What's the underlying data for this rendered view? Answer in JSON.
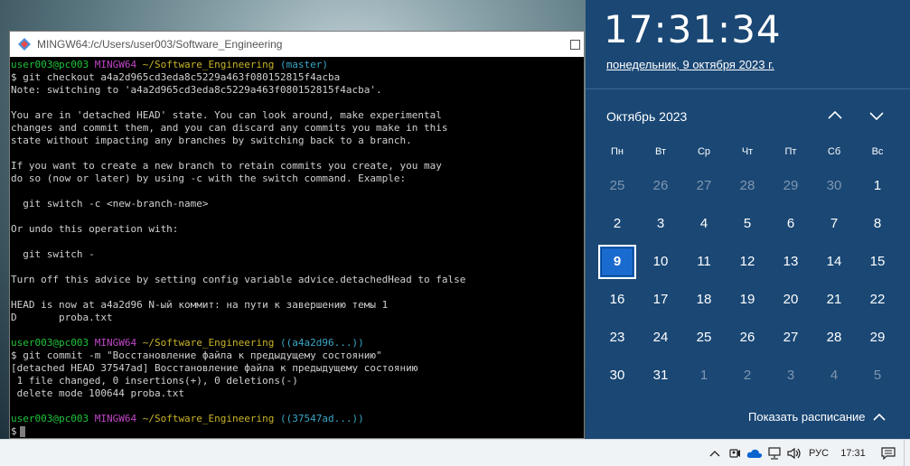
{
  "terminal": {
    "title": "MINGW64:/c/Users/user003/Software_Engineering",
    "lines": [
      [
        {
          "t": "user003@pc003 ",
          "c": "green"
        },
        {
          "t": "MINGW64 ",
          "c": "mag"
        },
        {
          "t": "~/Software_Engineering ",
          "c": "yel"
        },
        {
          "t": "(master)",
          "c": "cyan"
        }
      ],
      [
        {
          "t": "$ git checkout a4a2d965cd3eda8c5229a463f080152815f4acba",
          "c": ""
        }
      ],
      [
        {
          "t": "Note: switching to 'a4a2d965cd3eda8c5229a463f080152815f4acba'.",
          "c": ""
        }
      ],
      [
        {
          "t": "",
          "c": ""
        }
      ],
      [
        {
          "t": "You are in 'detached HEAD' state. You can look around, make experimental",
          "c": ""
        }
      ],
      [
        {
          "t": "changes and commit them, and you can discard any commits you make in this",
          "c": ""
        }
      ],
      [
        {
          "t": "state without impacting any branches by switching back to a branch.",
          "c": ""
        }
      ],
      [
        {
          "t": "",
          "c": ""
        }
      ],
      [
        {
          "t": "If you want to create a new branch to retain commits you create, you may",
          "c": ""
        }
      ],
      [
        {
          "t": "do so (now or later) by using -c with the switch command. Example:",
          "c": ""
        }
      ],
      [
        {
          "t": "",
          "c": ""
        }
      ],
      [
        {
          "t": "  git switch -c <new-branch-name>",
          "c": ""
        }
      ],
      [
        {
          "t": "",
          "c": ""
        }
      ],
      [
        {
          "t": "Or undo this operation with:",
          "c": ""
        }
      ],
      [
        {
          "t": "",
          "c": ""
        }
      ],
      [
        {
          "t": "  git switch -",
          "c": ""
        }
      ],
      [
        {
          "t": "",
          "c": ""
        }
      ],
      [
        {
          "t": "Turn off this advice by setting config variable advice.detachedHead to false",
          "c": ""
        }
      ],
      [
        {
          "t": "",
          "c": ""
        }
      ],
      [
        {
          "t": "HEAD is now at a4a2d96 N-ый коммит: на пути к завершению темы 1",
          "c": ""
        }
      ],
      [
        {
          "t": "D       proba.txt",
          "c": ""
        }
      ],
      [
        {
          "t": "",
          "c": ""
        }
      ],
      [
        {
          "t": "user003@pc003 ",
          "c": "green"
        },
        {
          "t": "MINGW64 ",
          "c": "mag"
        },
        {
          "t": "~/Software_Engineering ",
          "c": "yel"
        },
        {
          "t": "((a4a2d96...))",
          "c": "cyan"
        }
      ],
      [
        {
          "t": "$ git commit -m \"Восстановление файла к предыдущему состоянию\"",
          "c": ""
        }
      ],
      [
        {
          "t": "[detached HEAD 37547ad] Восстановление файла к предыдущему состоянию",
          "c": ""
        }
      ],
      [
        {
          "t": " 1 file changed, 0 insertions(+), 0 deletions(-)",
          "c": ""
        }
      ],
      [
        {
          "t": " delete mode 100644 proba.txt",
          "c": ""
        }
      ],
      [
        {
          "t": "",
          "c": ""
        }
      ],
      [
        {
          "t": "user003@pc003 ",
          "c": "green"
        },
        {
          "t": "MINGW64 ",
          "c": "mag"
        },
        {
          "t": "~/Software_Engineering ",
          "c": "yel"
        },
        {
          "t": "((37547ad...))",
          "c": "cyan"
        }
      ]
    ],
    "prompt": "$"
  },
  "flyout": {
    "time": "17:31:34",
    "date": "понедельник, 9 октября 2023 г.",
    "month": "Октябрь 2023",
    "weekdays": [
      "Пн",
      "Вт",
      "Ср",
      "Чт",
      "Пт",
      "Сб",
      "Вс"
    ],
    "days": [
      {
        "d": "25",
        "o": true
      },
      {
        "d": "26",
        "o": true
      },
      {
        "d": "27",
        "o": true
      },
      {
        "d": "28",
        "o": true
      },
      {
        "d": "29",
        "o": true
      },
      {
        "d": "30",
        "o": true
      },
      {
        "d": "1",
        "o": false
      },
      {
        "d": "2",
        "o": false
      },
      {
        "d": "3",
        "o": false
      },
      {
        "d": "4",
        "o": false
      },
      {
        "d": "5",
        "o": false
      },
      {
        "d": "6",
        "o": false
      },
      {
        "d": "7",
        "o": false
      },
      {
        "d": "8",
        "o": false
      },
      {
        "d": "9",
        "o": false,
        "today": true
      },
      {
        "d": "10",
        "o": false
      },
      {
        "d": "11",
        "o": false
      },
      {
        "d": "12",
        "o": false
      },
      {
        "d": "13",
        "o": false
      },
      {
        "d": "14",
        "o": false
      },
      {
        "d": "15",
        "o": false
      },
      {
        "d": "16",
        "o": false
      },
      {
        "d": "17",
        "o": false
      },
      {
        "d": "18",
        "o": false
      },
      {
        "d": "19",
        "o": false
      },
      {
        "d": "20",
        "o": false
      },
      {
        "d": "21",
        "o": false
      },
      {
        "d": "22",
        "o": false
      },
      {
        "d": "23",
        "o": false
      },
      {
        "d": "24",
        "o": false
      },
      {
        "d": "25",
        "o": false
      },
      {
        "d": "26",
        "o": false
      },
      {
        "d": "27",
        "o": false
      },
      {
        "d": "28",
        "o": false
      },
      {
        "d": "29",
        "o": false
      },
      {
        "d": "30",
        "o": false
      },
      {
        "d": "31",
        "o": false
      },
      {
        "d": "1",
        "o": true
      },
      {
        "d": "2",
        "o": true
      },
      {
        "d": "3",
        "o": true
      },
      {
        "d": "4",
        "o": true
      },
      {
        "d": "5",
        "o": true
      }
    ],
    "schedule_label": "Показать расписание"
  },
  "taskbar": {
    "lang": "РУС",
    "clock": "17:31",
    "icons": [
      "chevron-up-icon",
      "meet-now-icon",
      "onedrive-icon",
      "network-icon",
      "speaker-icon"
    ]
  }
}
